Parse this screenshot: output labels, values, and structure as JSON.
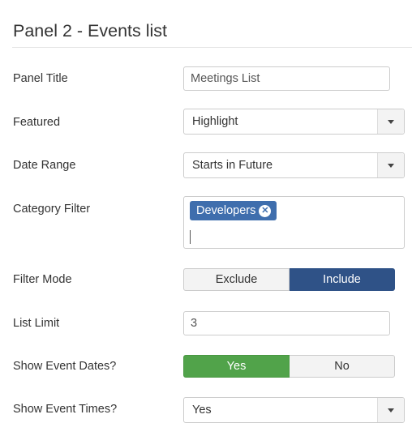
{
  "panel": {
    "title": "Panel 2 - Events list"
  },
  "fields": {
    "panel_title": {
      "label": "Panel Title",
      "value": "Meetings List"
    },
    "featured": {
      "label": "Featured",
      "value": "Highlight"
    },
    "date_range": {
      "label": "Date Range",
      "value": "Starts in Future"
    },
    "category_filter": {
      "label": "Category Filter",
      "tags": [
        "Developers"
      ],
      "remove_glyph": "✕"
    },
    "filter_mode": {
      "label": "Filter Mode",
      "options": [
        "Exclude",
        "Include"
      ],
      "selected": "Include"
    },
    "list_limit": {
      "label": "List Limit",
      "value": "3"
    },
    "show_event_dates": {
      "label": "Show Event Dates?",
      "options": [
        "Yes",
        "No"
      ],
      "selected": "Yes"
    },
    "show_event_times": {
      "label": "Show Event Times?",
      "value": "Yes"
    }
  },
  "colors": {
    "include_active": "#2f5287",
    "yes_active": "#51a34a",
    "tag": "#3f6ead"
  }
}
